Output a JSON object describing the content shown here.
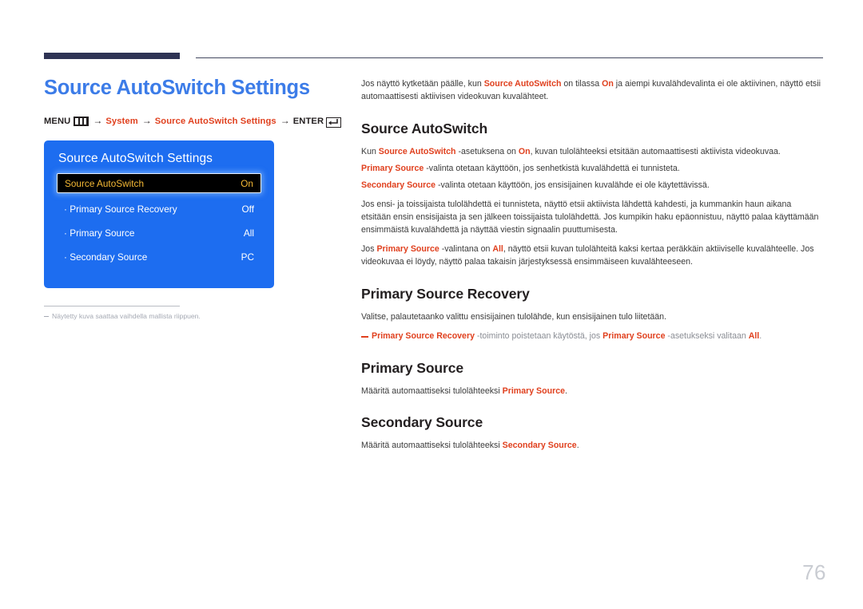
{
  "page": {
    "title": "Source AutoSwitch Settings",
    "number": "76"
  },
  "breadcrumb": {
    "menu_label": "MENU",
    "menu_icon": "menu-bars-icon",
    "arrow": "→",
    "step1": "System",
    "step2": "Source AutoSwitch Settings",
    "enter_label": "ENTER",
    "enter_icon": "enter-return-icon"
  },
  "osd": {
    "title": "Source AutoSwitch Settings",
    "rows": [
      {
        "label": "Source AutoSwitch",
        "value": "On",
        "selected": true
      },
      {
        "label": "· Primary Source Recovery",
        "value": "Off",
        "selected": false
      },
      {
        "label": "· Primary Source",
        "value": "All",
        "selected": false
      },
      {
        "label": "· Secondary Source",
        "value": "PC",
        "selected": false
      }
    ],
    "footnote": "Näytetty kuva saattaa vaihdella mallista riippuen."
  },
  "content": {
    "intro": {
      "a": "Jos näyttö kytketään päälle, kun ",
      "b": "Source AutoSwitch",
      "c": " on tilassa ",
      "d": "On",
      "e": " ja aiempi kuvalähdevalinta ei ole aktiivinen, näyttö etsii automaattisesti aktiivisen videokuvan kuvalähteet."
    },
    "sections": [
      {
        "heading": "Source AutoSwitch",
        "paragraphs": [
          {
            "a": "Kun ",
            "b": "Source AutoSwitch",
            "c": " -asetuksena on ",
            "d": "On",
            "e": ", kuvan tulolähteeksi etsitään automaattisesti aktiivista videokuvaa."
          },
          {
            "a": "",
            "b": "Primary Source",
            "c": " -valinta otetaan käyttöön, jos senhetkistä kuvalähdettä ei tunnisteta.",
            "d": "",
            "e": ""
          },
          {
            "a": "",
            "b": "Secondary Source",
            "c": " -valinta otetaan käyttöön, jos ensisijainen kuvalähde ei ole käytettävissä.",
            "d": "",
            "e": ""
          },
          {
            "a": "Jos ensi- ja toissijaista tulolähdettä ei tunnisteta, näyttö etsii aktiivista lähdettä kahdesti, ja kummankin haun aikana etsitään ensin ensisijaista ja sen jälkeen toissijaista tulolähdettä. Jos kumpikin haku epäonnistuu, näyttö palaa käyttämään ensimmäistä kuvalähdettä ja näyttää viestin signaalin puuttumisesta.",
            "b": "",
            "c": "",
            "d": "",
            "e": ""
          },
          {
            "a": "Jos ",
            "b": "Primary Source",
            "c": " -valintana on ",
            "d": "All",
            "e": ", näyttö etsii kuvan tulolähteitä kaksi kertaa peräkkäin aktiiviselle kuvalähteelle. Jos videokuvaa ei löydy, näyttö palaa takaisin järjestyksessä ensimmäiseen kuvalähteeseen."
          }
        ]
      }
    ],
    "primary_source_recovery": {
      "heading": "Primary Source Recovery",
      "paragraph": "Valitse, palautetaanko valittu ensisijainen tulolähde, kun ensisijainen tulo liitetään.",
      "note": {
        "a": "Primary Source Recovery",
        "b": " -toiminto poistetaan käytöstä, jos ",
        "c": "Primary Source",
        "d": " -asetukseksi valitaan ",
        "e": "All",
        "f": "."
      }
    },
    "primary_source": {
      "heading": "Primary Source",
      "p_a": "Määritä automaattiseksi tulolähteeksi ",
      "p_b": "Primary Source",
      "p_c": "."
    },
    "secondary_source": {
      "heading": "Secondary Source",
      "p_a": "Määritä automaattiseksi tulolähteeksi ",
      "p_b": "Secondary Source",
      "p_c": "."
    }
  },
  "colors": {
    "accent_blue": "#3c7ce8",
    "accent_red": "#e0401e",
    "osd_blue": "#1d6df0",
    "osd_highlight_text": "#f5b935",
    "header_navy": "#2e3354"
  }
}
